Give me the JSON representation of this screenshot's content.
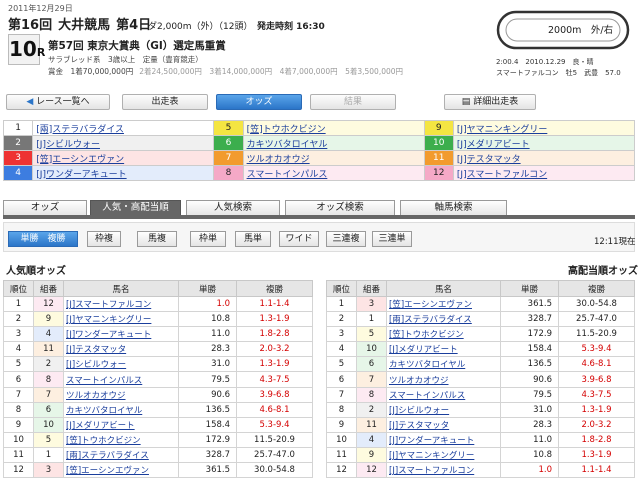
{
  "header": {
    "date": "2011年12月29日",
    "kai": "第16回",
    "venue": "大井競馬",
    "day": "第4日",
    "distance": "ダ2,000m（外）（12頭）",
    "post_time": "発走時刻 16:30",
    "race_no": "10",
    "race_suffix": "R",
    "race_name": "第57回 東京大賞典（GI）選定馬重賞",
    "conditions": "サラブレッド系　3歳以上　定量（豊育競走）",
    "prize": "賞金　1着70,000,000円",
    "prize_rest": "2着24,500,000円　3着14,000,000円　4着7,000,000円　5着3,500,000円",
    "course_label": "2000m　外/右",
    "record1": "2:00.4　2010.12.29　良・晴",
    "record2": "スマートファルコン　牡5　武豊　57.0"
  },
  "nav": {
    "list": "レース一覧へ",
    "entries": "出走表",
    "odds": "オッズ",
    "results": "結果",
    "detail": "詳細出走表"
  },
  "horses": [
    {
      "w": "1",
      "name": "[兩]ステラバラダイス"
    },
    {
      "w": "2",
      "name": "[J]シビルウォー"
    },
    {
      "w": "3",
      "name": "[笠]エーシンエヴァン"
    },
    {
      "w": "4",
      "name": "[J]ワンダーアキュート"
    },
    {
      "w": "5",
      "name": "[笠]トウホクビジン"
    },
    {
      "w": "6",
      "name": "カキツバタロイヤル"
    },
    {
      "w": "7",
      "name": "ツルオカオウジ"
    },
    {
      "w": "8",
      "name": "スマートインパルス"
    },
    {
      "w": "9",
      "name": "[J]ヤマニンキングリー"
    },
    {
      "w": "10",
      "name": "[J]メダリアビート"
    },
    {
      "w": "11",
      "name": "[J]テスタマッタ"
    },
    {
      "w": "12",
      "name": "[J]スマートファルコン"
    }
  ],
  "tabs": [
    "オッズ",
    "人気・高配当順",
    "人気検索",
    "オッズ検索",
    "軸馬検索"
  ],
  "bets": [
    "単勝　複勝",
    "枠複",
    "馬複",
    "枠単",
    "馬単",
    "ワイド",
    "三連複",
    "三連単"
  ],
  "as_of": "12:11現在",
  "left_title": "人気順オッズ",
  "right_title": "高配当順オッズ",
  "cols": [
    "順位",
    "組番",
    "馬名",
    "単勝",
    "複勝"
  ],
  "left_rows": [
    [
      "1",
      "12",
      "[J]スマートファルコン",
      "1.0",
      "1.1-1.4"
    ],
    [
      "2",
      "9",
      "[J]ヤマニンキングリー",
      "10.8",
      "1.3-1.9"
    ],
    [
      "3",
      "4",
      "[J]ワンダーアキュート",
      "11.0",
      "1.8-2.8"
    ],
    [
      "4",
      "11",
      "[J]テスタマッタ",
      "28.3",
      "2.0-3.2"
    ],
    [
      "5",
      "2",
      "[J]シビルウォー",
      "31.0",
      "1.3-1.9"
    ],
    [
      "6",
      "8",
      "スマートインパルス",
      "79.5",
      "4.3-7.5"
    ],
    [
      "7",
      "7",
      "ツルオカオウジ",
      "90.6",
      "3.9-6.8"
    ],
    [
      "8",
      "6",
      "カキツバタロイヤル",
      "136.5",
      "4.6-8.1"
    ],
    [
      "9",
      "10",
      "[J]メダリアビート",
      "158.4",
      "5.3-9.4"
    ],
    [
      "10",
      "5",
      "[笠]トウホクビジン",
      "172.9",
      "11.5-20.9"
    ],
    [
      "11",
      "1",
      "[兩]ステラバラダイス",
      "328.7",
      "25.7-47.0"
    ],
    [
      "12",
      "3",
      "[笠]エーシンエヴァン",
      "361.5",
      "30.0-54.8"
    ]
  ],
  "right_rows": [
    [
      "1",
      "3",
      "[笠]エーシンエヴァン",
      "361.5",
      "30.0-54.8"
    ],
    [
      "2",
      "1",
      "[兩]ステラバラダイス",
      "328.7",
      "25.7-47.0"
    ],
    [
      "3",
      "5",
      "[笠]トウホクビジン",
      "172.9",
      "11.5-20.9"
    ],
    [
      "4",
      "10",
      "[J]メダリアビート",
      "158.4",
      "5.3-9.4"
    ],
    [
      "5",
      "6",
      "カキツバタロイヤル",
      "136.5",
      "4.6-8.1"
    ],
    [
      "6",
      "7",
      "ツルオカオウジ",
      "90.6",
      "3.9-6.8"
    ],
    [
      "7",
      "8",
      "スマートインパルス",
      "79.5",
      "4.3-7.5"
    ],
    [
      "8",
      "2",
      "[J]シビルウォー",
      "31.0",
      "1.3-1.9"
    ],
    [
      "9",
      "11",
      "[J]テスタマッタ",
      "28.3",
      "2.0-3.2"
    ],
    [
      "10",
      "4",
      "[J]ワンダーアキュート",
      "11.0",
      "1.8-2.8"
    ],
    [
      "11",
      "9",
      "[J]ヤマニンキングリー",
      "10.8",
      "1.3-1.9"
    ],
    [
      "12",
      "12",
      "[J]スマートファルコン",
      "1.0",
      "1.1-1.4"
    ]
  ],
  "frame_of": {
    "1": "1",
    "2": "2",
    "3": "3",
    "4": "4",
    "5": "5",
    "6": "6",
    "7": "7",
    "8": "8",
    "9": "5",
    "10": "6",
    "11": "7",
    "12": "8"
  },
  "colors": {
    "accent": "#2b75c8",
    "hot_odds": "#d40000",
    "link": "#1a3e9c"
  }
}
